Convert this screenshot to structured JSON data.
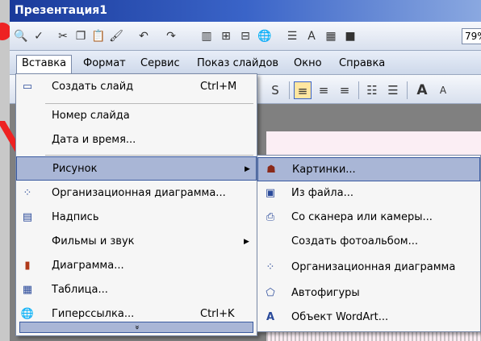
{
  "window": {
    "title": "Презентация1"
  },
  "toolbar": {
    "icons": [
      "print-preview-icon",
      "spelling-icon",
      "cut-icon",
      "copy-icon",
      "paste-icon",
      "format-painter-icon",
      "undo-icon",
      "redo-icon",
      "insert-chart-icon",
      "insert-table-icon",
      "tables-borders-icon",
      "insert-hyperlink-icon",
      "expand-icon",
      "show-formatting-icon",
      "show-grid-icon",
      "color-grayscale-icon"
    ],
    "zoom": "79%"
  },
  "menubar": {
    "items": [
      {
        "name": "Вставка",
        "active": true
      },
      {
        "name": "Формат",
        "active": false
      },
      {
        "name": "Сервис",
        "active": false
      },
      {
        "name": "Показ слайдов",
        "active": false
      },
      {
        "name": "Окно",
        "active": false
      },
      {
        "name": "Справка",
        "active": false
      }
    ]
  },
  "formatting_toolbar": {
    "icons": [
      "shadow-icon",
      "align-left-icon",
      "align-center-icon",
      "align-right-icon",
      "numbering-icon",
      "bullets-icon",
      "increase-font-icon",
      "decrease-font-icon"
    ]
  },
  "insert_menu": {
    "items": [
      {
        "label": "Создать слайд",
        "shortcut": "Ctrl+M",
        "icon": "new-slide-icon",
        "submenu": false,
        "highlighted": false
      },
      {
        "label": "Номер слайда",
        "shortcut": "",
        "icon": "",
        "submenu": false,
        "highlighted": false
      },
      {
        "label": "Дата и время...",
        "shortcut": "",
        "icon": "",
        "submenu": false,
        "highlighted": false
      },
      {
        "label": "Рисунок",
        "shortcut": "",
        "icon": "",
        "submenu": true,
        "highlighted": true
      },
      {
        "label": "Организационная диаграмма...",
        "shortcut": "",
        "icon": "org-chart-icon",
        "submenu": false,
        "highlighted": false
      },
      {
        "label": "Надпись",
        "shortcut": "",
        "icon": "text-box-icon",
        "submenu": false,
        "highlighted": false
      },
      {
        "label": "Фильмы и звук",
        "shortcut": "",
        "icon": "",
        "submenu": true,
        "highlighted": false
      },
      {
        "label": "Диаграмма...",
        "shortcut": "",
        "icon": "chart-icon",
        "submenu": false,
        "highlighted": false
      },
      {
        "label": "Таблица...",
        "shortcut": "",
        "icon": "table-icon",
        "submenu": false,
        "highlighted": false
      },
      {
        "label": "Гиперссылка...",
        "shortcut": "Ctrl+K",
        "icon": "hyperlink-icon",
        "submenu": false,
        "highlighted": false
      }
    ],
    "expand_glyph": "»"
  },
  "picture_submenu": {
    "items": [
      {
        "label": "Картинки...",
        "icon": "clip-art-icon",
        "highlighted": true
      },
      {
        "label": "Из файла...",
        "icon": "from-file-icon",
        "highlighted": false
      },
      {
        "label": "Со сканера или камеры...",
        "icon": "scanner-icon",
        "highlighted": false
      },
      {
        "label": "Создать фотоальбом...",
        "icon": "",
        "highlighted": false
      },
      {
        "label": "Организационная диаграмма",
        "icon": "org-chart-icon",
        "highlighted": false
      },
      {
        "label": "Автофигуры",
        "icon": "autoshapes-icon",
        "highlighted": false
      },
      {
        "label": "Объект WordArt...",
        "icon": "wordart-icon",
        "highlighted": false
      }
    ]
  }
}
